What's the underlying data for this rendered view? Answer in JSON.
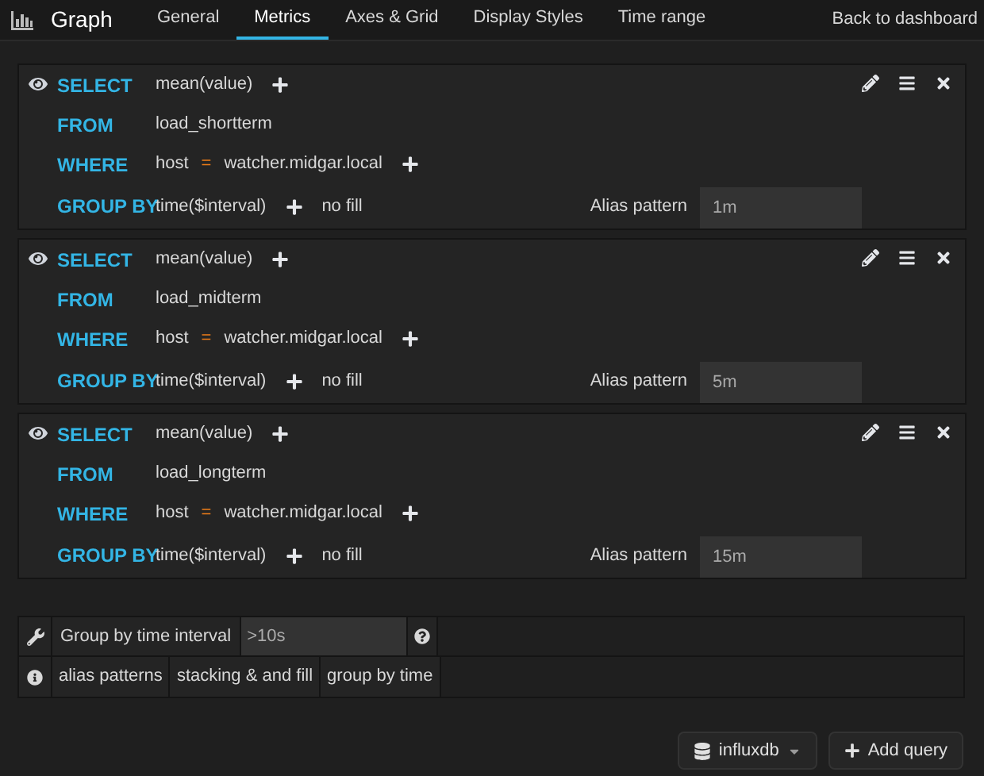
{
  "header": {
    "title": "Graph",
    "tabs": [
      {
        "label": "General",
        "selected": false
      },
      {
        "label": "Metrics",
        "selected": true
      },
      {
        "label": "Axes & Grid",
        "selected": false
      },
      {
        "label": "Display Styles",
        "selected": false
      },
      {
        "label": "Time range",
        "selected": false
      }
    ],
    "back_link": "Back to dashboard"
  },
  "queries": [
    {
      "select_label": "SELECT",
      "select": "mean(value)",
      "from_label": "FROM",
      "from": "load_shortterm",
      "where_label": "WHERE",
      "where_key": "host",
      "where_op": "=",
      "where_value": "watcher.midgar.local",
      "group_label": "GROUP BY",
      "group": "time($interval)",
      "fill": "no fill",
      "alias_label": "Alias pattern",
      "alias": "1m"
    },
    {
      "select_label": "SELECT",
      "select": "mean(value)",
      "from_label": "FROM",
      "from": "load_midterm",
      "where_label": "WHERE",
      "where_key": "host",
      "where_op": "=",
      "where_value": "watcher.midgar.local",
      "group_label": "GROUP BY",
      "group": "time($interval)",
      "fill": "no fill",
      "alias_label": "Alias pattern",
      "alias": "5m"
    },
    {
      "select_label": "SELECT",
      "select": "mean(value)",
      "from_label": "FROM",
      "from": "load_longterm",
      "where_label": "WHERE",
      "where_key": "host",
      "where_op": "=",
      "where_value": "watcher.midgar.local",
      "group_label": "GROUP BY",
      "group": "time($interval)",
      "fill": "no fill",
      "alias_label": "Alias pattern",
      "alias": "15m"
    }
  ],
  "options": {
    "interval_label": "Group by time interval",
    "interval_placeholder": ">10s",
    "help_links": [
      "alias patterns",
      "stacking & and fill",
      "group by time"
    ]
  },
  "footer": {
    "datasource": "influxdb",
    "add_query": "Add query"
  }
}
